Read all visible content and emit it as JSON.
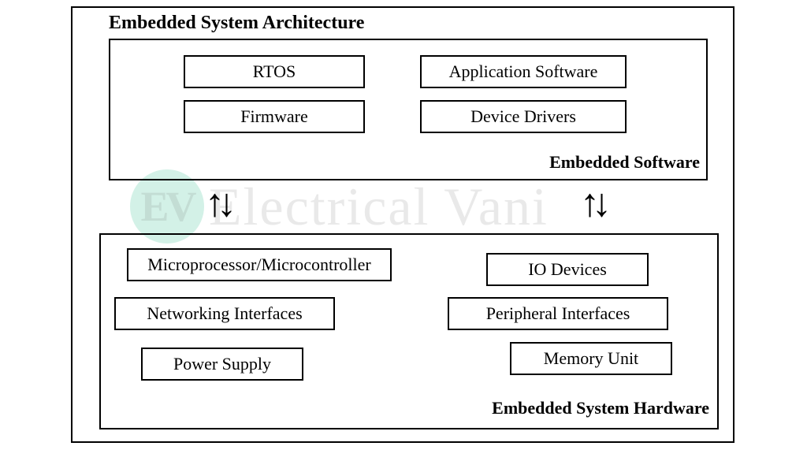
{
  "title": "Embedded System Architecture",
  "software": {
    "label": "Embedded Software",
    "items": {
      "rtos": "RTOS",
      "firmware": "Firmware",
      "appsw": "Application Software",
      "devdrv": "Device Drivers"
    }
  },
  "hardware": {
    "label": "Embedded System Hardware",
    "items": {
      "mpu": "Microprocessor/Microcontroller",
      "neti": "Networking Interfaces",
      "pwr": "Power Supply",
      "io": "IO Devices",
      "peri": "Peripheral Interfaces",
      "mem": "Memory Unit"
    }
  },
  "arrows": {
    "updown": "↑↓"
  },
  "watermark": {
    "badge": "EV",
    "text": "Electrical Vani"
  }
}
